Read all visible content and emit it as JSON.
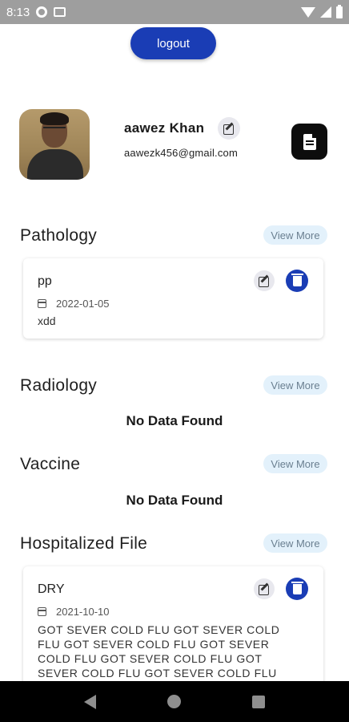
{
  "status_bar": {
    "time": "8:13"
  },
  "logout_label": "logout",
  "profile": {
    "name": "aawez Khan",
    "email": "aawezk456@gmail.com"
  },
  "view_more_label": "View More",
  "no_data_label": "No Data Found",
  "sections": {
    "pathology": {
      "title": "Pathology",
      "card": {
        "title": "pp",
        "date": "2022-01-05",
        "description": "xdd"
      }
    },
    "radiology": {
      "title": "Radiology"
    },
    "vaccine": {
      "title": "Vaccine"
    },
    "hospitalized": {
      "title": "Hospitalized File",
      "card": {
        "title": "DRY",
        "date": "2021-10-10",
        "description": "GOT SEVER COLD FLU GOT SEVER COLD FLU GOT SEVER COLD FLU GOT SEVER COLD FLU GOT SEVER COLD FLU GOT SEVER COLD FLU GOT SEVER COLD FLU"
      }
    }
  },
  "icons": {
    "status_left": [
      "settings-icon",
      "image-icon"
    ],
    "status_right": [
      "wifi-icon",
      "signal-icon",
      "battery-icon"
    ],
    "nav": [
      "back-icon",
      "home-icon",
      "recents-icon"
    ]
  }
}
